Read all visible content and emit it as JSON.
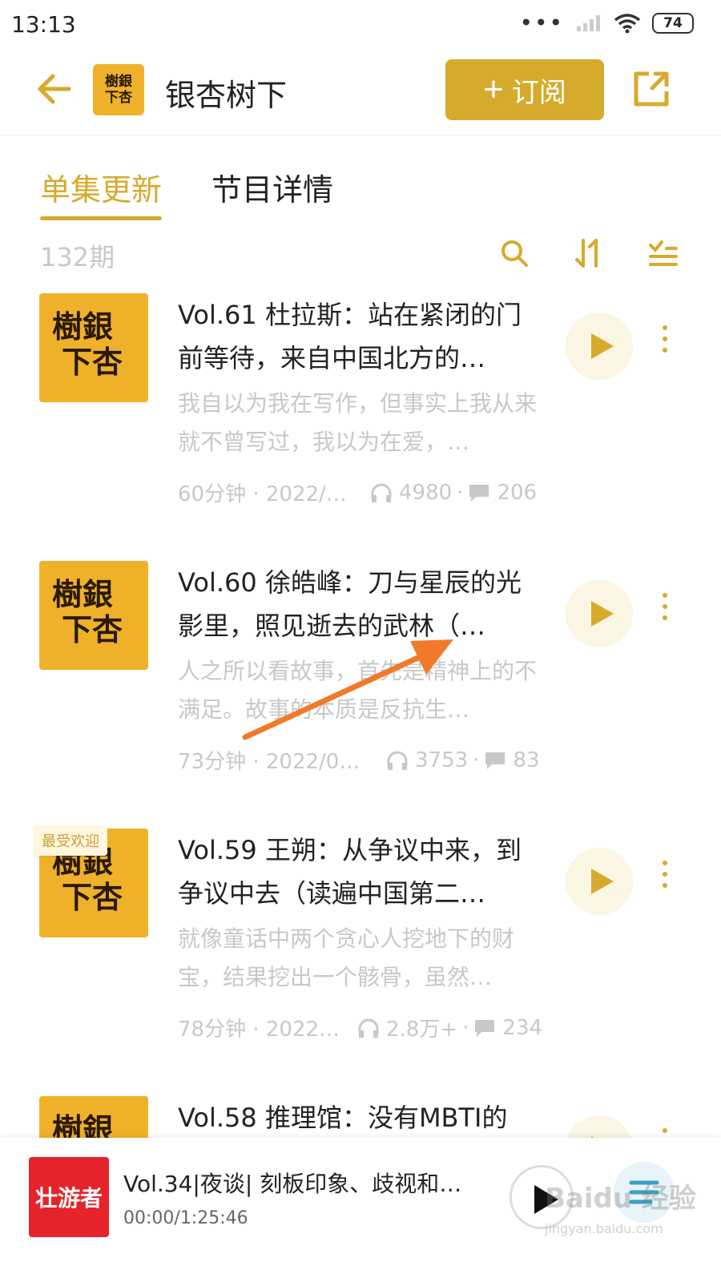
{
  "status": {
    "time": "13:13",
    "battery": "74"
  },
  "header": {
    "title": "银杏树下",
    "subscribe_label": "订阅",
    "logo_text": [
      "樹銀",
      "下杏"
    ]
  },
  "tabs": [
    {
      "label": "单集更新",
      "active": true
    },
    {
      "label": "节目详情",
      "active": false
    }
  ],
  "episode_count": "132期",
  "episodes": [
    {
      "title": "Vol.61 杜拉斯：站在紧闭的门前等待，来自中国北方的…",
      "desc": "我自以为我在写作，但事实上我从来就不曾写过，我以为在爱，…",
      "duration_date": "60分钟 · 2022/…",
      "plays": "4980",
      "comments": "206",
      "badge": ""
    },
    {
      "title": "Vol.60 徐皓峰：刀与星辰的光影里，照见逝去的武林（…",
      "desc": "人之所以看故事，首先是精神上的不满足。故事的本质是反抗生…",
      "duration_date": "73分钟 · 2022/0…",
      "plays": "3753",
      "comments": "83",
      "badge": ""
    },
    {
      "title": "Vol.59 王朔：从争议中来，到争议中去（读遍中国第二…",
      "desc": "就像童话中两个贪心人挖地下的财宝，结果挖出一个骸骨，虽然…",
      "duration_date": "78分钟 · 2022…",
      "plays": "2.8万+",
      "comments": "234",
      "badge": "最受欢迎"
    },
    {
      "title": "Vol.58 推理馆：没有MBTI的",
      "desc": "",
      "duration_date": "",
      "plays": "",
      "comments": "",
      "badge": ""
    }
  ],
  "player": {
    "title": "Vol.34|夜谈| 刻板印象、歧视和…",
    "time": "00:00/1:25:46",
    "cover_text": "壮游者"
  },
  "watermark": {
    "line1": "Baidu 经验",
    "line2": "jingyan.baidu.com"
  },
  "colors": {
    "accent": "#d6aa2d",
    "cover": "#f0b12a",
    "player_cover": "#e4232b",
    "annotation_arrow": "#f07a2a"
  },
  "icons": [
    "back-arrow-icon",
    "share-icon",
    "search-icon",
    "sort-icon",
    "filter-list-icon",
    "headphones-icon",
    "comment-icon",
    "play-icon",
    "more-icon",
    "playlist-icon"
  ]
}
